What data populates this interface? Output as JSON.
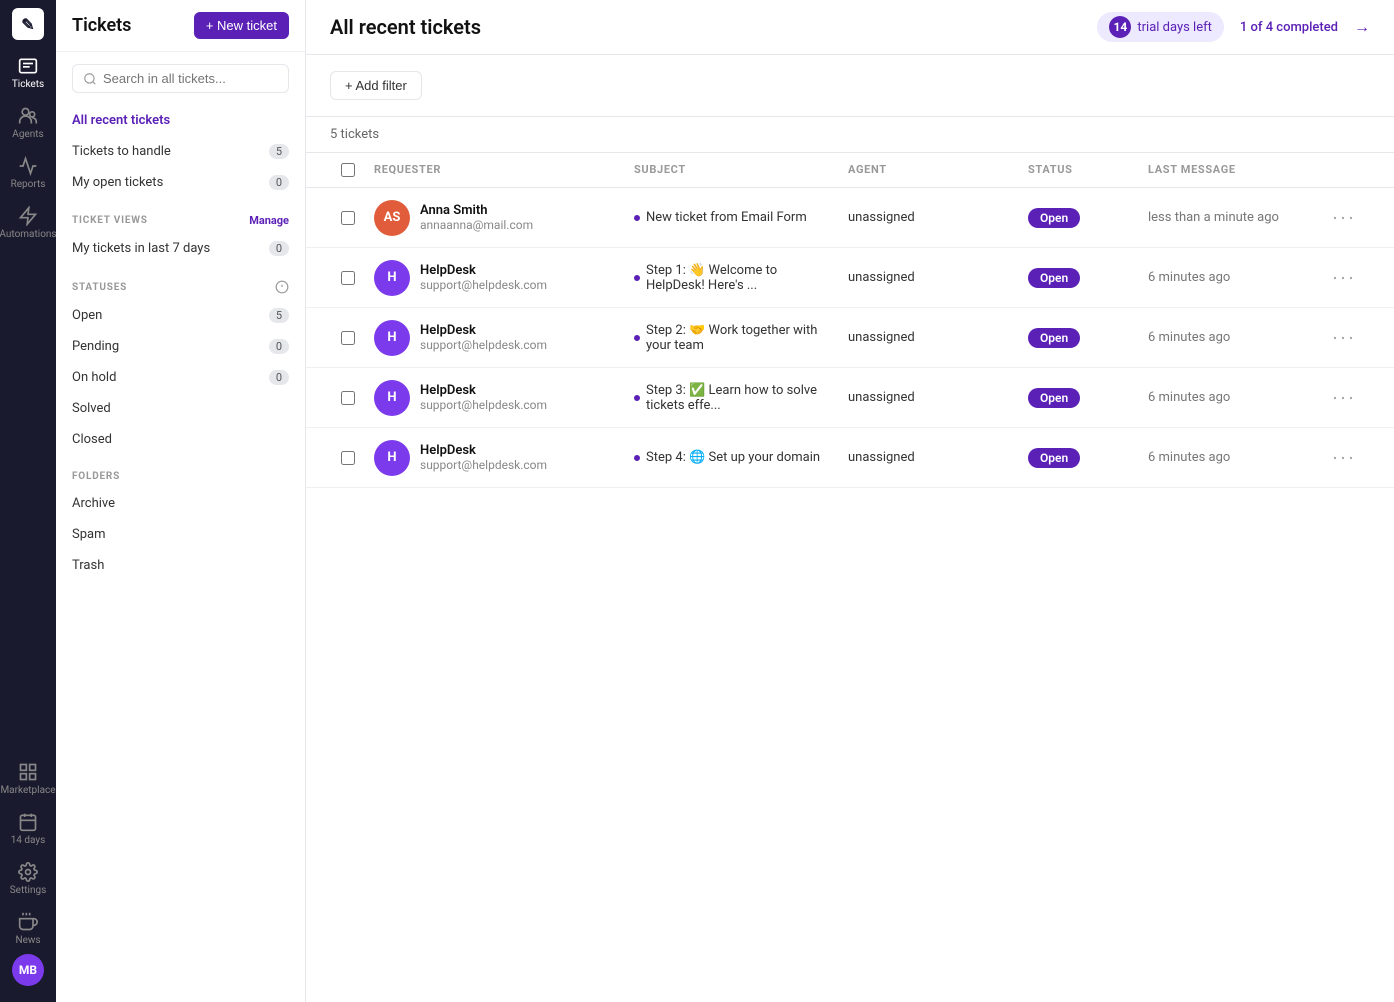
{
  "nav": {
    "logo_text": "✎",
    "items": [
      {
        "id": "tickets",
        "label": "Tickets",
        "icon": "ticket",
        "active": true
      },
      {
        "id": "agents",
        "label": "Agents",
        "icon": "agents",
        "active": false
      },
      {
        "id": "reports",
        "label": "Reports",
        "icon": "reports",
        "active": false
      },
      {
        "id": "automations",
        "label": "Automations",
        "icon": "automations",
        "active": false
      }
    ],
    "bottom_items": [
      {
        "id": "marketplace",
        "label": "Marketplace",
        "icon": "marketplace"
      },
      {
        "id": "14days",
        "label": "14 days",
        "icon": "days"
      },
      {
        "id": "settings",
        "label": "Settings",
        "icon": "settings"
      },
      {
        "id": "news",
        "label": "News",
        "icon": "news"
      }
    ],
    "avatar_initials": "MB"
  },
  "sidebar": {
    "title": "Tickets",
    "new_ticket_label": "+ New ticket",
    "search_placeholder": "Search in all tickets...",
    "all_recent_label": "All recent tickets",
    "nav_items": [
      {
        "id": "tickets-to-handle",
        "label": "Tickets to handle",
        "badge": "5"
      },
      {
        "id": "my-open-tickets",
        "label": "My open tickets",
        "badge": "0"
      }
    ],
    "ticket_views_label": "TICKET VIEWS",
    "manage_label": "Manage",
    "views": [
      {
        "id": "my-tickets-last-7-days",
        "label": "My tickets in last 7 days",
        "badge": "0"
      }
    ],
    "statuses_label": "STATUSES",
    "statuses": [
      {
        "id": "open",
        "label": "Open",
        "badge": "5"
      },
      {
        "id": "pending",
        "label": "Pending",
        "badge": "0"
      },
      {
        "id": "on-hold",
        "label": "On hold",
        "badge": "0"
      },
      {
        "id": "solved",
        "label": "Solved",
        "badge": null
      },
      {
        "id": "closed",
        "label": "Closed",
        "badge": null
      }
    ],
    "folders_label": "FOLDERS",
    "folders": [
      {
        "id": "archive",
        "label": "Archive"
      },
      {
        "id": "spam",
        "label": "Spam"
      },
      {
        "id": "trash",
        "label": "Trash"
      }
    ]
  },
  "main": {
    "title": "All recent tickets",
    "trial_days_num": "14",
    "trial_days_label": "trial days left",
    "completed_text": "1 of 4 completed",
    "add_filter_label": "+ Add filter",
    "ticket_count": "5 tickets",
    "columns": [
      {
        "id": "checkbox",
        "label": ""
      },
      {
        "id": "requester",
        "label": "REQUESTER"
      },
      {
        "id": "subject",
        "label": "SUBJECT"
      },
      {
        "id": "agent",
        "label": "AGENT"
      },
      {
        "id": "status",
        "label": "STATUS"
      },
      {
        "id": "last_message",
        "label": "LAST MESSAGE"
      },
      {
        "id": "actions",
        "label": ""
      }
    ],
    "tickets": [
      {
        "id": "1",
        "avatar_initials": "AS",
        "avatar_color": "#e05c3a",
        "requester_name": "Anna Smith",
        "requester_email": "annaanna@mail.com",
        "subject": "New ticket from Email Form",
        "agent": "unassigned",
        "status": "Open",
        "last_message": "less than a minute ago"
      },
      {
        "id": "2",
        "avatar_initials": "H",
        "avatar_color": "#7c3aed",
        "requester_name": "HelpDesk",
        "requester_email": "support@helpdesk.com",
        "subject": "Step 1: 👋 Welcome to HelpDesk! Here's ...",
        "agent": "unassigned",
        "status": "Open",
        "last_message": "6 minutes ago"
      },
      {
        "id": "3",
        "avatar_initials": "H",
        "avatar_color": "#7c3aed",
        "requester_name": "HelpDesk",
        "requester_email": "support@helpdesk.com",
        "subject": "Step 2: 🤝 Work together with your team",
        "agent": "unassigned",
        "status": "Open",
        "last_message": "6 minutes ago"
      },
      {
        "id": "4",
        "avatar_initials": "H",
        "avatar_color": "#7c3aed",
        "requester_name": "HelpDesk",
        "requester_email": "support@helpdesk.com",
        "subject": "Step 3: ✅ Learn how to solve tickets effe...",
        "agent": "unassigned",
        "status": "Open",
        "last_message": "6 minutes ago"
      },
      {
        "id": "5",
        "avatar_initials": "H",
        "avatar_color": "#7c3aed",
        "requester_name": "HelpDesk",
        "requester_email": "support@helpdesk.com",
        "subject": "Step 4: 🌐 Set up your domain",
        "agent": "unassigned",
        "status": "Open",
        "last_message": "6 minutes ago"
      }
    ]
  }
}
